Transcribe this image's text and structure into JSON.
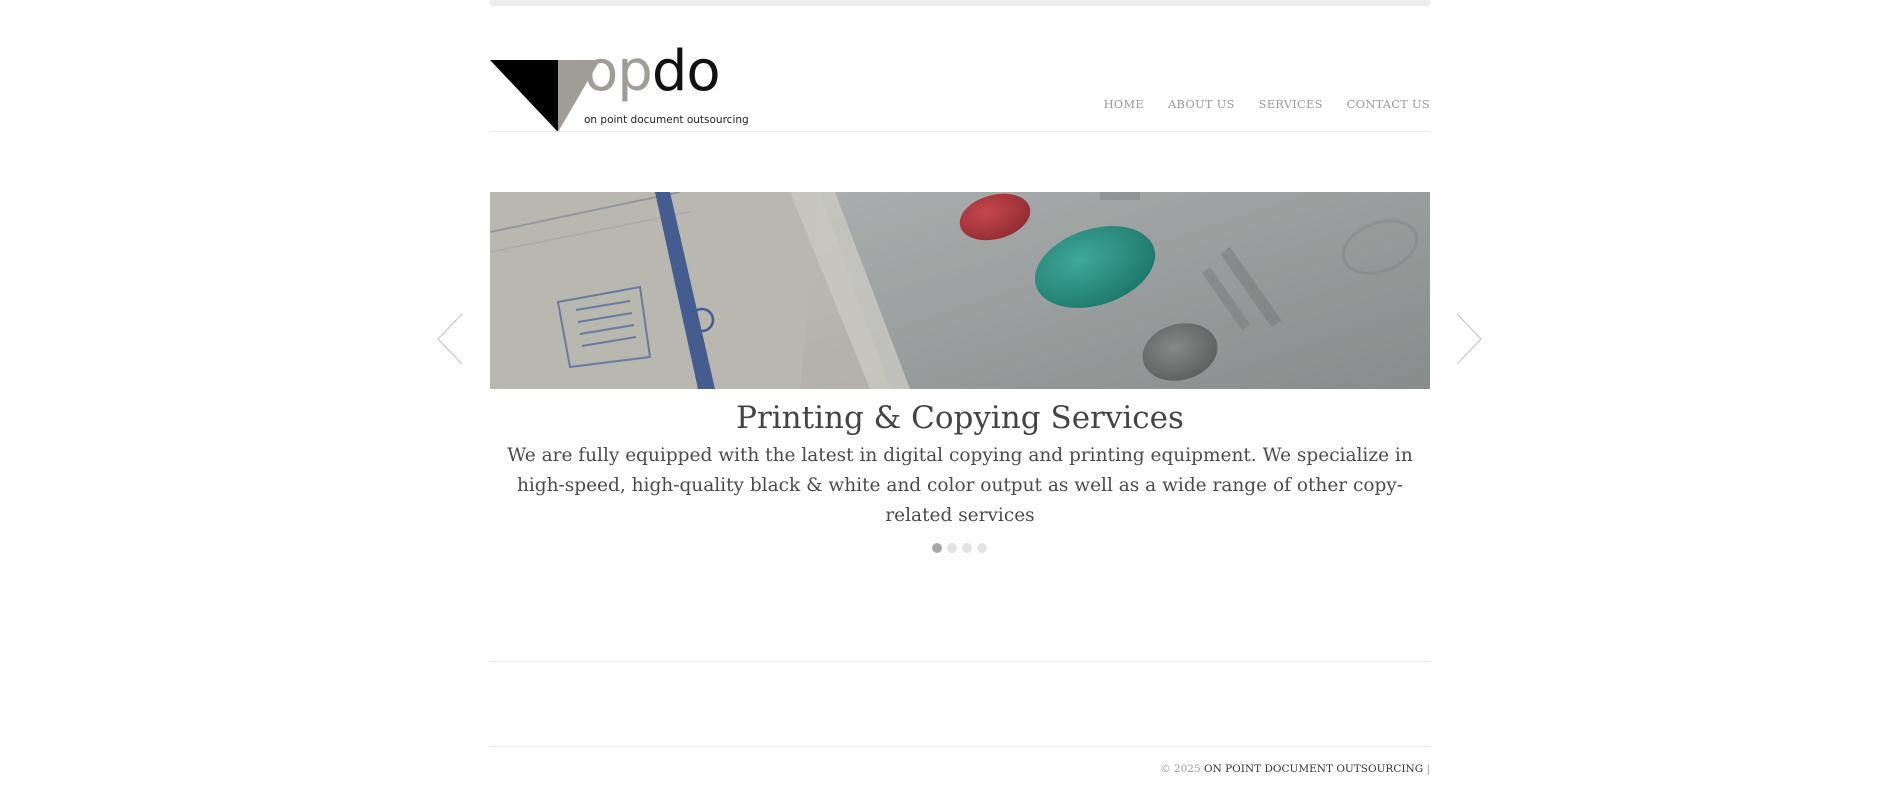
{
  "brand": {
    "logo_op": "op",
    "logo_do": "do",
    "tagline": "on point document outsourcing"
  },
  "nav": {
    "items": [
      {
        "label": "HOME"
      },
      {
        "label": "ABOUT US"
      },
      {
        "label": "SERVICES"
      },
      {
        "label": "CONTACT US"
      }
    ]
  },
  "slider": {
    "title": "Printing & Copying Services",
    "description": "We are fully equipped with the latest in digital copying and printing equipment. We specialize in high-speed, high-quality black & white and color output as well as a wide range of other copy-related services",
    "active_index": 0,
    "slide_count": 4
  },
  "footer": {
    "copyright": "© 2025",
    "company": "ON POINT DOCUMENT OUTSOURCING",
    "separator": "|"
  },
  "colors": {
    "nav_text": "#9a9a9a",
    "body_text": "#4a4a4a",
    "dot_active": "#a8a8a8",
    "dot_inactive": "#e2e2e2"
  },
  "icons": {
    "prev": "chevron-left-icon",
    "next": "chevron-right-icon"
  }
}
